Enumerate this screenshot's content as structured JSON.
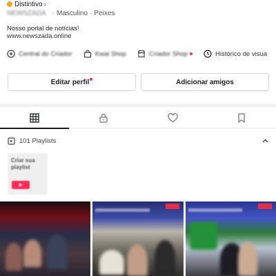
{
  "profile": {
    "badge_label": "Distintivo",
    "username": "NEWSZADA",
    "gender": "Masculino",
    "category": "Peixes",
    "meta_sep": "·",
    "bio_line": "Nosso portal de notícias!",
    "bio_link": "www.newszada.online"
  },
  "quick_links": [
    {
      "label": "Central do Criador",
      "icon": "creator-center-icon"
    },
    {
      "label": "Kwai Shop",
      "icon": "shopping-bag-icon"
    },
    {
      "label": "Criador Shop",
      "icon": "store-icon"
    },
    {
      "label": "Histórico de visua",
      "icon": "history-clock-icon"
    }
  ],
  "actions": {
    "edit_profile": "Editar perfil",
    "add_friends": "Adicionar amigos"
  },
  "tabs": [
    {
      "name": "videos-grid",
      "icon": "grid-icon",
      "active": true
    },
    {
      "name": "private",
      "icon": "lock-icon",
      "active": false
    },
    {
      "name": "liked",
      "icon": "heart-icon",
      "active": false
    },
    {
      "name": "saved",
      "icon": "bookmark-icon",
      "active": false
    }
  ],
  "playlists": {
    "label": "101 Playlists",
    "create_card_label": "Criar sua playlist"
  },
  "colors": {
    "accent": "#fe2c55",
    "badge": "#f5a623",
    "text": "#161823"
  }
}
